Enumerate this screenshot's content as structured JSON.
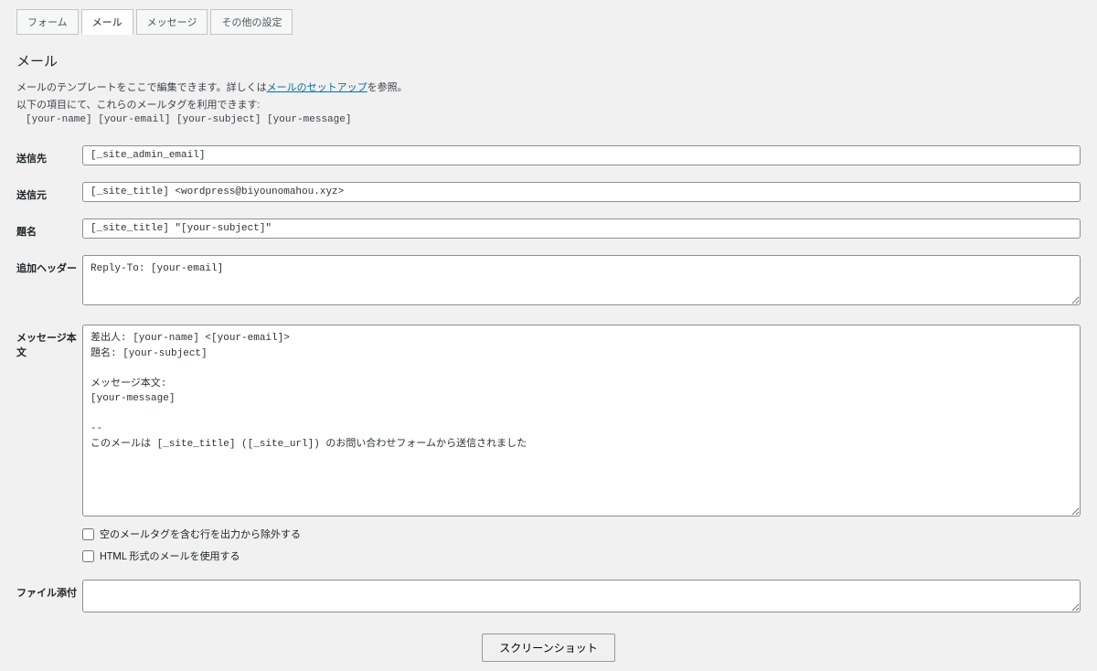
{
  "tabs": {
    "form": "フォーム",
    "mail": "メール",
    "messages": "メッセージ",
    "other": "その他の設定"
  },
  "section": {
    "title": "メール",
    "intro_before": "メールのテンプレートをここで編集できます。詳しくは",
    "intro_link": "メールのセットアップ",
    "intro_after": "を参照。",
    "tags_label": "以下の項目にて、これらのメールタグを利用できます:",
    "tags_list": "[your-name] [your-email] [your-subject] [your-message]"
  },
  "fields": {
    "to": {
      "label": "送信先",
      "value": "[_site_admin_email]"
    },
    "from": {
      "label": "送信元",
      "value": "[_site_title] <wordpress@biyounomahou.xyz>"
    },
    "subject": {
      "label": "題名",
      "value": "[_site_title] \"[your-subject]\""
    },
    "headers": {
      "label": "追加ヘッダー",
      "value": "Reply-To: [your-email]"
    },
    "body": {
      "label": "メッセージ本文",
      "value": "差出人: [your-name] <[your-email]>\n題名: [your-subject]\n\nメッセージ本文:\n[your-message]\n\n-- \nこのメールは [_site_title] ([_site_url]) のお問い合わせフォームから送信されました"
    },
    "attach": {
      "label": "ファイル添付",
      "value": ""
    }
  },
  "checkboxes": {
    "exclude_blank": "空のメールタグを含む行を出力から除外する",
    "use_html": "HTML 形式のメールを使用する"
  },
  "bottom_button": "スクリーンショット"
}
